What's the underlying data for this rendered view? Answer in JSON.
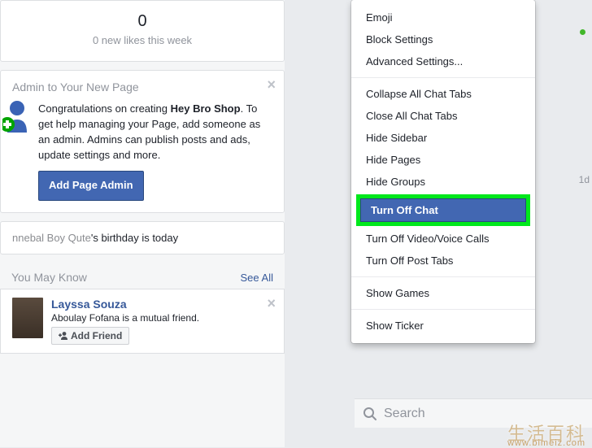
{
  "likes": {
    "count": "0",
    "sub": "0 new likes this week"
  },
  "admin": {
    "title": "Admin to Your New Page",
    "text_pre": "Congratulations on creating ",
    "brand": "Hey Bro Shop",
    "text_post": ". To get help managing your Page, add someone as an admin. Admins can publish posts and ads, update settings and more.",
    "button": "Add Page Admin"
  },
  "birthday": {
    "name": "nnebal Boy Qute",
    "suffix": "'s birthday is today"
  },
  "pymk": {
    "title": "You May Know",
    "see_all": "See All",
    "item": {
      "name": "Layssa Souza",
      "mutual": "Aboulay Fofana is a mutual friend.",
      "button": "Add Friend"
    }
  },
  "menu": {
    "group1": [
      "Emoji",
      "Block Settings",
      "Advanced Settings..."
    ],
    "group2": [
      "Collapse All Chat Tabs",
      "Close All Chat Tabs",
      "Hide Sidebar",
      "Hide Pages",
      "Hide Groups"
    ],
    "highlighted": "Turn Off Chat",
    "group2b": [
      "Turn Off Video/Voice Calls",
      "Turn Off Post Tabs"
    ],
    "group3": [
      "Show Games"
    ],
    "group4": [
      "Show Ticker"
    ]
  },
  "sidebar_time": "1d",
  "search": {
    "placeholder": "Search"
  },
  "watermark": {
    "main": "生活百科",
    "sub": "www.bimeiz.com"
  }
}
